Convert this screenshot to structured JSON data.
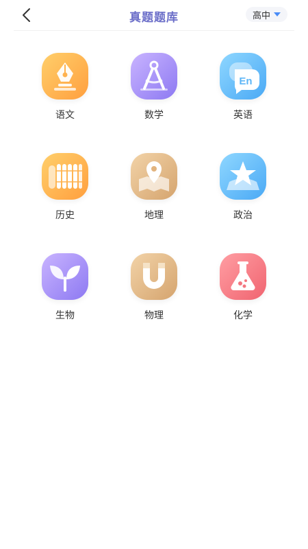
{
  "header": {
    "title": "真题题库",
    "level": "高中"
  },
  "subjects": [
    {
      "label": "语文",
      "icon": "fountain-pen-icon",
      "gradient": "orange"
    },
    {
      "label": "数学",
      "icon": "compass-icon",
      "gradient": "purple"
    },
    {
      "label": "英语",
      "icon": "en-speech-bubble-icon",
      "gradient": "blue"
    },
    {
      "label": "历史",
      "icon": "bamboo-scroll-icon",
      "gradient": "orange"
    },
    {
      "label": "地理",
      "icon": "map-pin-icon",
      "gradient": "tan"
    },
    {
      "label": "政治",
      "icon": "star-icon",
      "gradient": "blue"
    },
    {
      "label": "生物",
      "icon": "sprout-icon",
      "gradient": "purple"
    },
    {
      "label": "物理",
      "icon": "magnet-icon",
      "gradient": "tan"
    },
    {
      "label": "化学",
      "icon": "flask-icon",
      "gradient": "red"
    }
  ]
}
